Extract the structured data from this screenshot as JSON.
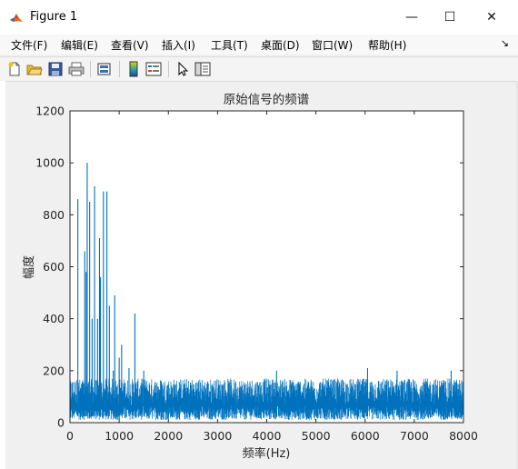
{
  "window": {
    "title": "Figure 1",
    "controls": {
      "minimize": "—",
      "maximize": "☐",
      "close": "✕"
    }
  },
  "menu": {
    "items": [
      "文件(F)",
      "编辑(E)",
      "查看(V)",
      "插入(I)",
      "工具(T)",
      "桌面(D)",
      "窗口(W)",
      "帮助(H)"
    ],
    "overflow": "↘"
  },
  "toolbar": {
    "icons": [
      "new-figure-icon",
      "open-file-icon",
      "save-icon",
      "print-icon",
      "link-plot-icon",
      "colorbar-icon",
      "legend-icon",
      "pointer-icon",
      "property-inspector-icon"
    ]
  },
  "colors": {
    "series": "#0072BD",
    "axes_bg": "#ffffff",
    "figure_bg": "#f0f0f0"
  },
  "chart_data": {
    "type": "line",
    "title": "原始信号的频谱",
    "xlabel": "频率(Hz)",
    "ylabel": "幅度",
    "xlim": [
      0,
      8000
    ],
    "ylim": [
      0,
      1200
    ],
    "xticks": [
      0,
      1000,
      2000,
      3000,
      4000,
      5000,
      6000,
      7000,
      8000
    ],
    "yticks": [
      0,
      200,
      400,
      600,
      800,
      1000,
      1200
    ],
    "grid": false,
    "noise_floor": {
      "x_range": [
        0,
        8000
      ],
      "y_range": [
        10,
        170
      ]
    },
    "peaks": [
      {
        "x": 160,
        "y": 860
      },
      {
        "x": 300,
        "y": 660
      },
      {
        "x": 330,
        "y": 580
      },
      {
        "x": 350,
        "y": 1000
      },
      {
        "x": 400,
        "y": 850
      },
      {
        "x": 450,
        "y": 400
      },
      {
        "x": 500,
        "y": 910
      },
      {
        "x": 560,
        "y": 400
      },
      {
        "x": 600,
        "y": 710
      },
      {
        "x": 620,
        "y": 560
      },
      {
        "x": 680,
        "y": 890
      },
      {
        "x": 750,
        "y": 890
      },
      {
        "x": 800,
        "y": 450
      },
      {
        "x": 880,
        "y": 200
      },
      {
        "x": 910,
        "y": 490
      },
      {
        "x": 1000,
        "y": 250
      },
      {
        "x": 1050,
        "y": 300
      },
      {
        "x": 1200,
        "y": 210
      },
      {
        "x": 1320,
        "y": 420
      },
      {
        "x": 1500,
        "y": 200
      },
      {
        "x": 4200,
        "y": 200
      },
      {
        "x": 6050,
        "y": 210
      },
      {
        "x": 6650,
        "y": 200
      },
      {
        "x": 7750,
        "y": 200
      }
    ]
  }
}
